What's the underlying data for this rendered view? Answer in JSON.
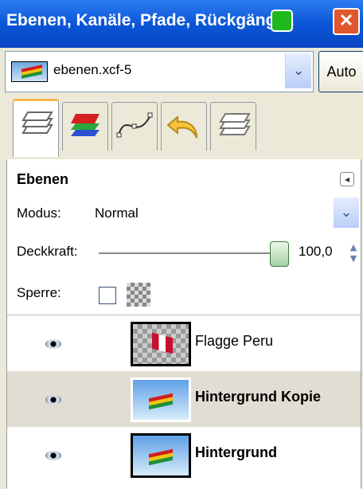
{
  "window": {
    "title": "Ebenen, Kanäle, Pfade, Rückgängi...",
    "close_glyph": "✕"
  },
  "image_menu": {
    "selected": "ebenen.xcf-5",
    "dropdown_glyph": "⌄",
    "auto_label": "Auto"
  },
  "tabs": [
    {
      "name": "layers",
      "icon": "layers-icon"
    },
    {
      "name": "channels",
      "icon": "channels-icon"
    },
    {
      "name": "paths",
      "icon": "paths-icon"
    },
    {
      "name": "undo",
      "icon": "undo-icon"
    },
    {
      "name": "history",
      "icon": "layers-icon"
    }
  ],
  "panel": {
    "title": "Ebenen",
    "menu_glyph": "◂",
    "mode_label": "Modus:",
    "mode_value": "Normal",
    "opacity_label": "Deckkraft:",
    "opacity_value": "100,0",
    "lock_label": "Sperre:"
  },
  "layers": [
    {
      "name": "Flagge Peru",
      "visible": true,
      "selected": false,
      "bold": false
    },
    {
      "name": "Hintergrund Kopie",
      "visible": true,
      "selected": true,
      "bold": true
    },
    {
      "name": "Hintergrund",
      "visible": true,
      "selected": false,
      "bold": true
    }
  ]
}
